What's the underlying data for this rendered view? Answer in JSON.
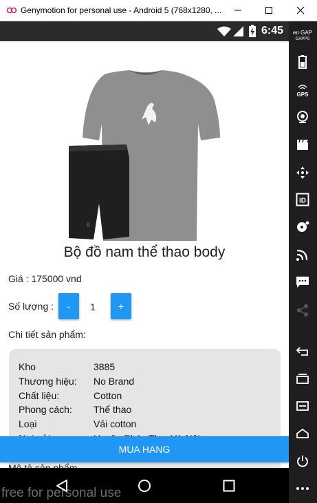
{
  "window": {
    "title": "Genymotion for personal use - Android 5 (768x1280, ...",
    "app_icon": "genymotion-logo-icon",
    "controls": [
      "minimize-icon",
      "maximize-icon",
      "close-icon"
    ]
  },
  "statusbar": {
    "time": "6:45",
    "icons": [
      "wifi-icon",
      "signal-icon",
      "battery-charging-icon"
    ],
    "background": "#2b2b2b"
  },
  "product": {
    "image_icon": "sportswear-set-image",
    "name": "Bộ đồ nam thể thao body",
    "price_label": "Giá : 175000 vnd",
    "quantity_label": "Số lượng :",
    "quantity_minus": "-",
    "quantity_value": "1",
    "quantity_plus": "+",
    "details_label": "Chi tiết sản phẩm:",
    "details": [
      {
        "key": "Kho",
        "value": "3885"
      },
      {
        "key": "Thương hiệu:",
        "value": "No Brand"
      },
      {
        "key": "Chất liệu:",
        "value": "Cotton"
      },
      {
        "key": "Phong cách:",
        "value": "Thể thao"
      },
      {
        "key": "Loại",
        "value": "Vải cotton"
      },
      {
        "key": "Nơi gửi:",
        "value": "Huyện Phúc Thọ, Hà Nội"
      }
    ],
    "buy_button": "MUA HANG",
    "below_text": "Mô tả sản phẩm"
  },
  "navbar": {
    "icons": [
      "back-triangle-icon",
      "home-circle-icon",
      "recents-square-icon"
    ]
  },
  "watermark": "free for personal use",
  "sidebar": {
    "open_gapps_label": "Open GAPPS",
    "gps_label": "GPS",
    "items": [
      "open-gapps-icon",
      "battery-icon",
      "gps-icon",
      "webcam-icon",
      "capture-icon",
      "dpad-icon",
      "device-id-icon",
      "disk-icon",
      "cast-icon",
      "sms-icon",
      "share-icon",
      "back-icon",
      "recent-apps-icon",
      "menu-icon",
      "home-icon",
      "power-icon",
      "more-icon"
    ]
  },
  "colors": {
    "accent": "#2196f3",
    "card": "#e6e5e4",
    "sidebar": "#1e1e1e",
    "navbar": "#000000"
  }
}
